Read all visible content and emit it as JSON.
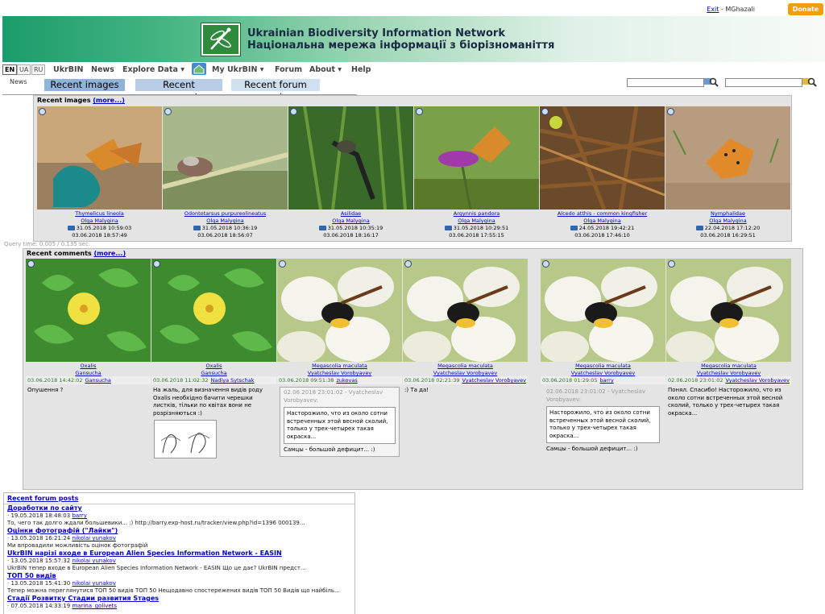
{
  "topbar": {
    "exit_label": "Exit",
    "user": " - MGhazali",
    "donate_label": "Donate"
  },
  "banner": {
    "title_en": "Ukrainian Biodiversity Information Network",
    "title_ua": "Національна мережа інформації з біорізноманіття"
  },
  "languages": [
    "EN",
    "UA",
    "RU"
  ],
  "menu": {
    "ukrbin": "UkrBIN",
    "news": "News",
    "explore": "Explore Data",
    "my": "My UkrBIN",
    "forum": "Forum",
    "about": "About",
    "help": "Help"
  },
  "news_label": "News",
  "tabs": [
    "Recent images",
    "Recent comments",
    "Recent forum posts"
  ],
  "query_time": "Query time: 0.005 / 0.135 sec.",
  "recent_images": {
    "title": "Recent images",
    "more": "(more...)",
    "items": [
      {
        "species": "Thymelicus lineola",
        "author": "Olga Malygina",
        "date": "31.05.2018 10:59:03",
        "added": "03.06.2018 18:57:49"
      },
      {
        "species": "Odontotarsus purpureolineatus",
        "author": "Olga Malygina",
        "date": "31.05.2018 10:36:19",
        "added": "03.06.2018 18:56:07"
      },
      {
        "species": "Asilidae",
        "author": "Olga Malygina",
        "date": "31.05.2018 10:35:19",
        "added": "03.06.2018 18:16:17"
      },
      {
        "species": "Argynnis pandora",
        "author": "Olga Malygina",
        "date": "31.05.2018 10:29:51",
        "added": "03.06.2018 17:55:15"
      },
      {
        "species": "Alcedo atthis - common kingfisher",
        "author": "Olga Malygina",
        "date": "24.05.2018 19:42:21",
        "added": "03.06.2018 17:46:10"
      },
      {
        "species": "Nymphalidae",
        "author": "Olga Malygina",
        "date": "22.04.2018 17:12:20",
        "added": "03.06.2018 16:29:51"
      }
    ]
  },
  "recent_comments": {
    "title": "Recent comments",
    "more": "(more...)",
    "items": [
      {
        "species": "Oxalis",
        "author": "Gansucha",
        "date": "03.06.2018 14:42:02",
        "commenter": "Gansucha",
        "text": "Опушення ?"
      },
      {
        "species": "Oxalis",
        "author": "Gansucha",
        "date": "03.06.2018 11:02:32",
        "commenter": "Nadiya Sytschak",
        "text": "На жаль, для визначення видів роду Oxalis необхідно бачити черешки листків, тільки по квітах вони не розрізняються :)"
      },
      {
        "species": "Megascolia maculata",
        "author": "Vyatcheslav Vorobyavev",
        "date": "03.06.2018 09:51:38",
        "commenter": "zukovas",
        "quote_head": "02.06.2018 23:01:02 - Vyatcheslav Vorobyavev:",
        "quote": "Насторожило, что из около сотни встреченных этой весной сколий, только у трех-четырех такая окраска...",
        "text": "Самцы - большой дефицит... :)"
      },
      {
        "species": "Megascolia maculata",
        "author": "Vyatcheslav Vorobyavev",
        "date": "03.06.2018 02:21:39",
        "commenter": "Vyatcheslav Vorobyavev",
        "text": ":) Та да!"
      },
      {
        "species": "Megascolia maculata",
        "author": "Vyatcheslav Vorobyavev",
        "date": "03.06.2018 01:29:05",
        "commenter": "barry",
        "quote_head": "02.06.2018 23:01:02 - Vyatcheslav Vorobyavev:",
        "quote": "Насторожило, что из около сотни встреченных этой весной сколий, только у трех-четырех такая окраска...",
        "text": "Самцы - большой дефицит... :)"
      },
      {
        "species": "Megascolia maculata",
        "author": "Vyatcheslav Vorobyavev",
        "date": "02.06.2018 23:01:02",
        "commenter": "Vyatcheslav Vorobyavev",
        "text": "Понял. Спасибо! Насторожило, что из около сотни встреченных этой весной сколий, только у трех-четырех такая окраска..."
      }
    ]
  },
  "forum": {
    "title": "Recent forum posts",
    "items": [
      {
        "title": "Доработки по сайту",
        "date": "· 19.05.2018 18:48:03",
        "author": "barry",
        "excerpt": "То, чего так долго ждали большевики... :) http://barry.exp-host.ru/tracker/view.php?id=1396 000139..."
      },
      {
        "title": "Оцінки фотографій (\"Лайки\")",
        "date": "· 13.05.2018 16:21:24",
        "author": "nikolai yunakov",
        "excerpt": "Ми впровадили можливість оцінок фотографій"
      },
      {
        "title": "UkrBIN нарізі входе в European Alien Species Information Network - EASIN",
        "date": "· 13.05.2018 15:57:32",
        "author": "nikolai yunakov",
        "excerpt": "UkrBIN тепер входе в European Alien Species Information Network - EASIN Що це дає? UkrBIN предст..."
      },
      {
        "title": "ТОП 50 видів",
        "date": "· 13.05.2018 15:41:30",
        "author": "nikolai yunakov",
        "excerpt": "Тепер можна переглянутися ТОП 50 видів ТОП 50 Нещодавно спостережених видів ТОП 50 Видів що найбіль..."
      },
      {
        "title": "Стадії Розвитку Стадии развития Sтages",
        "date": "· 07.05.2018 14:33:19",
        "author": "marina_golivets",
        "excerpt": ""
      }
    ]
  },
  "colors": {
    "accent": "#0000cc",
    "donate": "#f39c12",
    "panel": "#e4e4e4"
  }
}
